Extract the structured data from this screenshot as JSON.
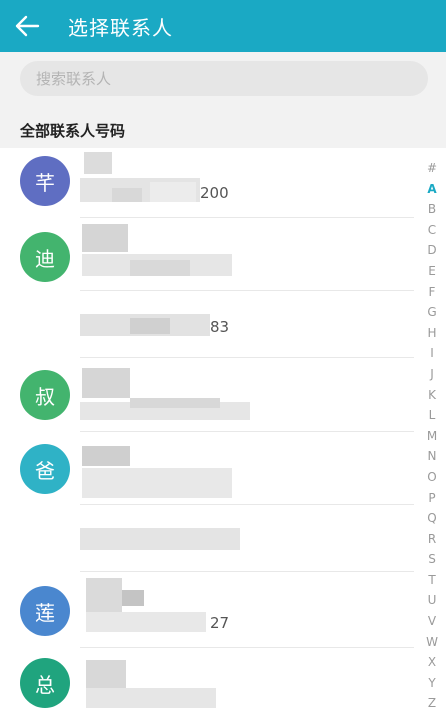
{
  "header": {
    "title": "选择联系人",
    "back_icon": "arrow-left-icon",
    "bar_color": "#1aa9c4"
  },
  "search": {
    "placeholder": "搜索联系人",
    "value": ""
  },
  "section": {
    "title": "全部联系人号码"
  },
  "contacts": [
    {
      "avatar_char": "芊",
      "avatar_color": "#5f6ec2",
      "number_suffix": "200"
    },
    {
      "avatar_char": "迪",
      "avatar_color": "#43b46e",
      "number_suffix": "83"
    },
    {
      "avatar_char": "叔",
      "avatar_color": "#43b46e",
      "number_suffix": ""
    },
    {
      "avatar_char": "爸",
      "avatar_color": "#2fb2c6",
      "number_suffix": ""
    },
    {
      "avatar_char": "莲",
      "avatar_color": "#4a87cf",
      "number_suffix": "27"
    },
    {
      "avatar_char": "总",
      "avatar_color": "#20a47e",
      "number_suffix": ""
    }
  ],
  "index_bar": {
    "letters": [
      "#",
      "A",
      "B",
      "C",
      "D",
      "E",
      "F",
      "G",
      "H",
      "I",
      "J",
      "K",
      "L",
      "M",
      "N",
      "O",
      "P",
      "Q",
      "R",
      "S",
      "T",
      "U",
      "V",
      "W",
      "X",
      "Y",
      "Z"
    ],
    "active": "A"
  }
}
